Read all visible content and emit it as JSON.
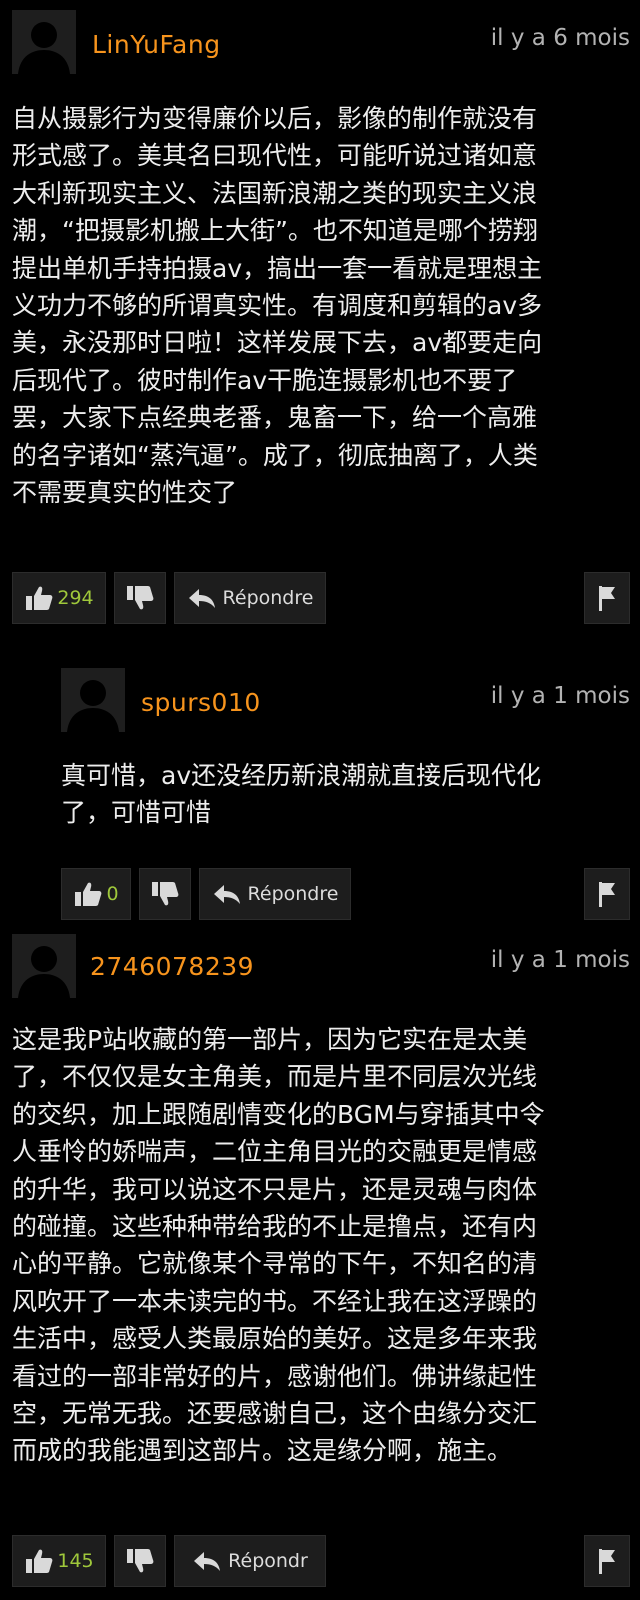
{
  "comments": [
    {
      "username": "LinYuFang",
      "time": "il y a 6 mois",
      "lines": [
        "自从摄影行为变得廉价以后，影像的制作就没有",
        "形式感了。美其名曰现代性，可能听说过诸如意",
        "大利新现实主义、法国新浪潮之类的现实主义浪",
        "潮，“把摄影机搬上大街”。也不知道是哪个捞翔",
        "提出单机手持拍摄av，搞出一套一看就是理想主",
        "义功力不够的所谓真实性。有调度和剪辑的av多",
        "美，永没那时日啦！这样发展下去，av都要走向",
        "后现代了。彼时制作av干脆连摄影机也不要了",
        "罢，大家下点经典老番，鬼畜一下，给一个高雅",
        "的名字诸如“蒸汽逼”。成了，彻底抽离了，人类",
        "不需要真实的性交了"
      ],
      "likes": "294",
      "reply_label": "Répondre"
    },
    {
      "username": "spurs010",
      "time": "il y a 1 mois",
      "lines": [
        "真可惜，av还没经历新浪潮就直接后现代化",
        "了，可惜可惜"
      ],
      "likes": "0",
      "reply_label": "Répondre"
    },
    {
      "username": "2746078239",
      "time": "il y a 1 mois",
      "lines": [
        "这是我P站收藏的第一部片，因为它实在是太美",
        "了，不仅仅是女主角美，而是片里不同层次光线",
        "的交织，加上跟随剧情变化的BGM与穿插其中令",
        "人垂怜的娇喘声，二位主角目光的交融更是情感",
        "的升华，我可以说这不只是片，还是灵魂与肉体",
        "的碰撞。这些种种带给我的不止是撸点，还有内",
        "心的平静。它就像某个寻常的下午，不知名的清",
        "风吹开了一本未读完的书。不经让我在这浮躁的",
        "生活中，感受人类最原始的美好。这是多年来我",
        "看过的一部非常好的片，感谢他们。佛讲缘起性",
        "空，无常无我。还要感谢自己，这个由缘分交汇",
        "而成的我能遇到这部片。这是缘分啊，施主。"
      ],
      "likes": "145",
      "reply_label": "Répondr"
    }
  ],
  "icons": {
    "avatar": "default-user-silhouette",
    "like": "thumbs-up-icon",
    "dislike": "thumbs-down-icon",
    "reply": "reply-arrow-icon",
    "flag": "flag-icon"
  },
  "colors": {
    "background": "#000000",
    "username": "#f7941d",
    "like_count": "#9fc83b",
    "button_bg": "#1d1d1d"
  }
}
